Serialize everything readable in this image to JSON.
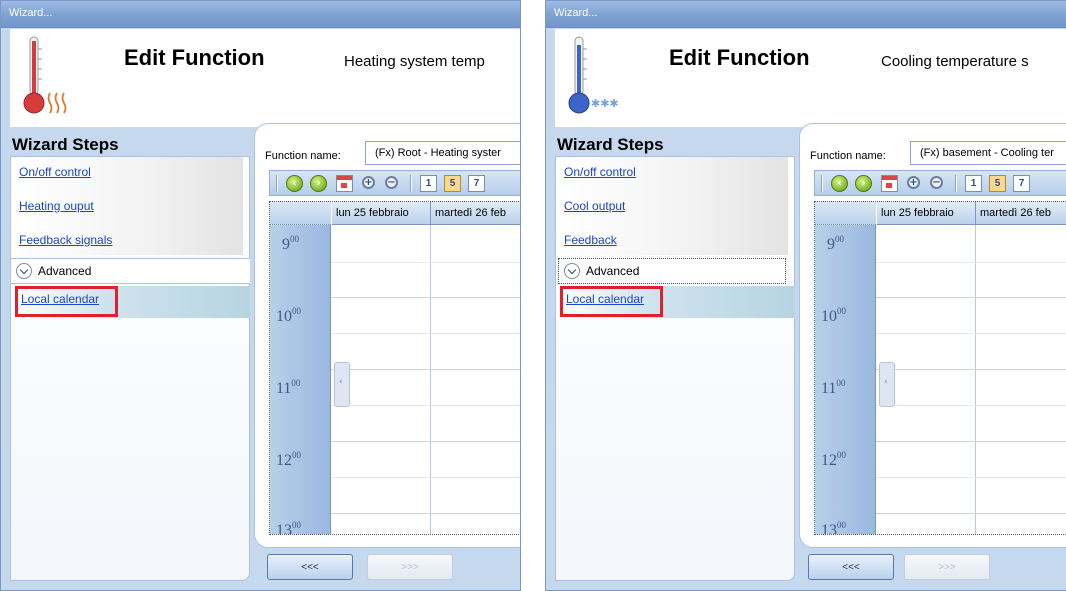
{
  "panels": [
    {
      "window_title": "Wizard...",
      "edit_title": "Edit Function",
      "function_description": "Heating system temp",
      "wizard_steps_title": "Wizard Steps",
      "steps": [
        "On/off control",
        "Heating ouput",
        "Feedback signals"
      ],
      "advanced_label": "Advanced",
      "selected_step": "Local calendar",
      "function_name_label": "Function name:",
      "function_name_value": "(Fx) Root - Heating syster",
      "day_headers": [
        "lun 25 febbraio",
        "martedì 26 feb"
      ],
      "hours": [
        {
          "h": "9",
          "m": "00"
        },
        {
          "h": "10",
          "m": "00"
        },
        {
          "h": "11",
          "m": "00"
        },
        {
          "h": "12",
          "m": "00"
        },
        {
          "h": "13",
          "m": "00"
        }
      ],
      "toolbar_day_buttons": [
        "1",
        "5",
        "7"
      ],
      "prev_label": "<<<",
      "next_label": ">>>",
      "icon": "thermometer-heat-icon"
    },
    {
      "window_title": "Wizard...",
      "edit_title": "Edit Function",
      "function_description": "Cooling temperature s",
      "wizard_steps_title": "Wizard Steps",
      "steps": [
        "On/off control",
        "Cool output",
        "Feedback"
      ],
      "advanced_label": "Advanced",
      "selected_step": "Local calendar",
      "function_name_label": "Function name:",
      "function_name_value": "(Fx) basement - Cooling ter",
      "day_headers": [
        "lun 25 febbraio",
        "martedì 26 feb"
      ],
      "hours": [
        {
          "h": "9",
          "m": "00"
        },
        {
          "h": "10",
          "m": "00"
        },
        {
          "h": "11",
          "m": "00"
        },
        {
          "h": "12",
          "m": "00"
        },
        {
          "h": "13",
          "m": "00"
        }
      ],
      "toolbar_day_buttons": [
        "1",
        "5",
        "7"
      ],
      "prev_label": "<<<",
      "next_label": ">>>",
      "icon": "thermometer-snow-icon"
    }
  ],
  "colors": {
    "highlight_border": "#e0202a",
    "link": "#1a47c2",
    "titlebar": "#7ea1d2"
  }
}
